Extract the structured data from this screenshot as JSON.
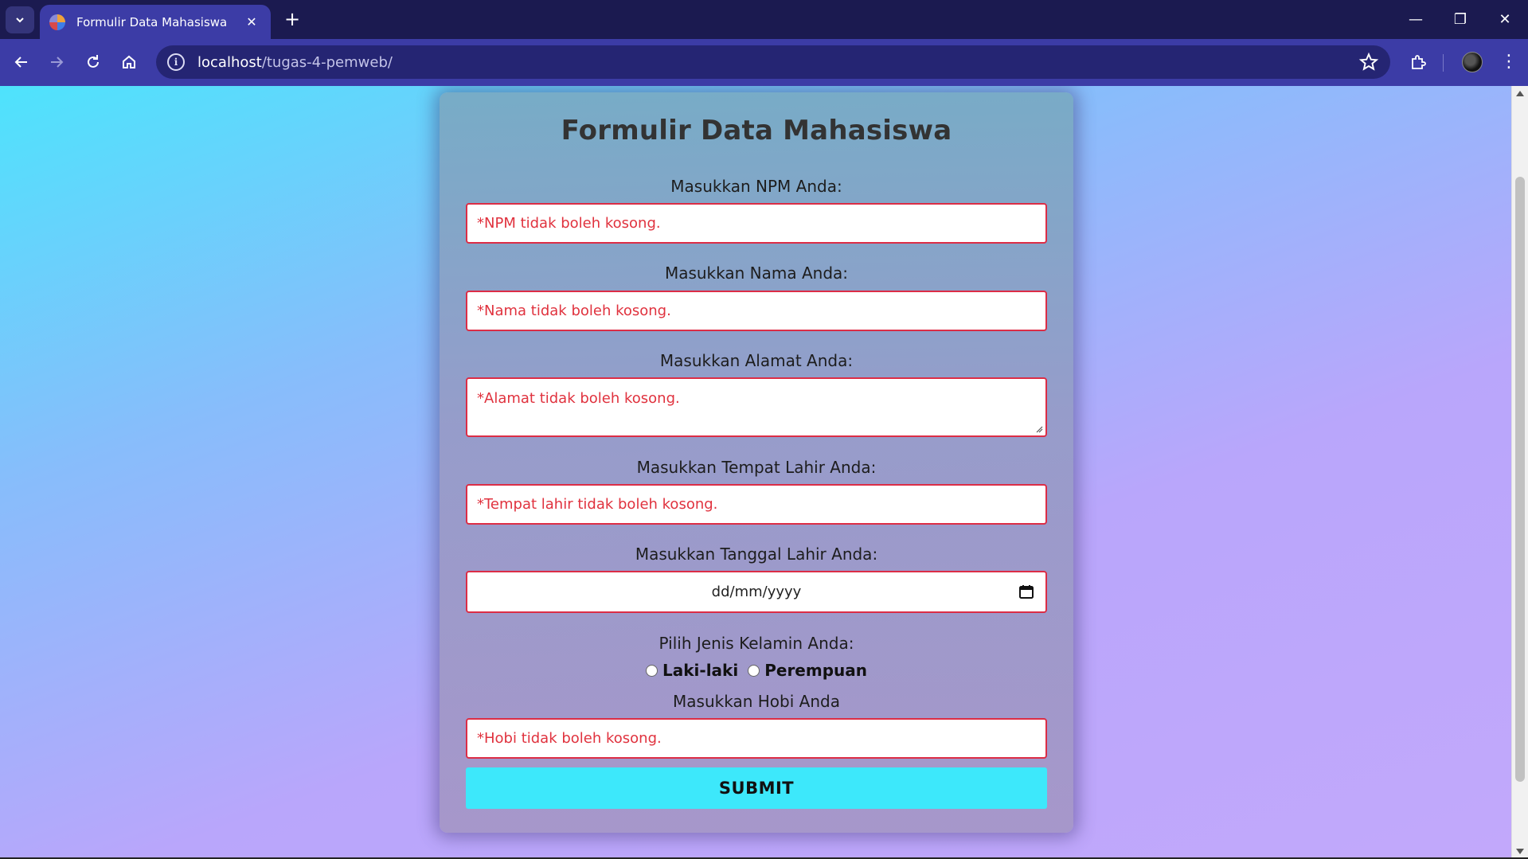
{
  "browser": {
    "tab_title": "Formulir Data Mahasiswa",
    "tab_close": "✕",
    "new_tab": "+",
    "url_host": "localhost",
    "url_path": "/tugas-4-pemweb/",
    "window_controls": {
      "minimize": "—",
      "restore": "❐",
      "close": "✕"
    },
    "menu": "⋮"
  },
  "form": {
    "title": "Formulir Data Mahasiswa",
    "npm": {
      "label": "Masukkan NPM Anda:",
      "error": "*NPM tidak boleh kosong."
    },
    "nama": {
      "label": "Masukkan Nama Anda:",
      "error": "*Nama tidak boleh kosong."
    },
    "alamat": {
      "label": "Masukkan Alamat Anda:",
      "error": "*Alamat tidak boleh kosong."
    },
    "tempat_lahir": {
      "label": "Masukkan Tempat Lahir Anda:",
      "error": "*Tempat lahir tidak boleh kosong."
    },
    "tanggal_lahir": {
      "label": "Masukkan Tanggal Lahir Anda:",
      "placeholder": "dd/mm/yyyy"
    },
    "jenis_kelamin": {
      "label": "Pilih Jenis Kelamin Anda:",
      "options": [
        "Laki-laki",
        "Perempuan"
      ]
    },
    "hobi": {
      "label": "Masukkan Hobi Anda",
      "error": "*Hobi tidak boleh kosong."
    },
    "submit_label": "SUBMIT"
  },
  "colors": {
    "error_text": "#e0323e",
    "error_border": "#dc2d46",
    "submit_bg": "#3de8fb",
    "chrome_dark": "#1b1a50",
    "chrome_toolbar": "#3c3ca6"
  }
}
